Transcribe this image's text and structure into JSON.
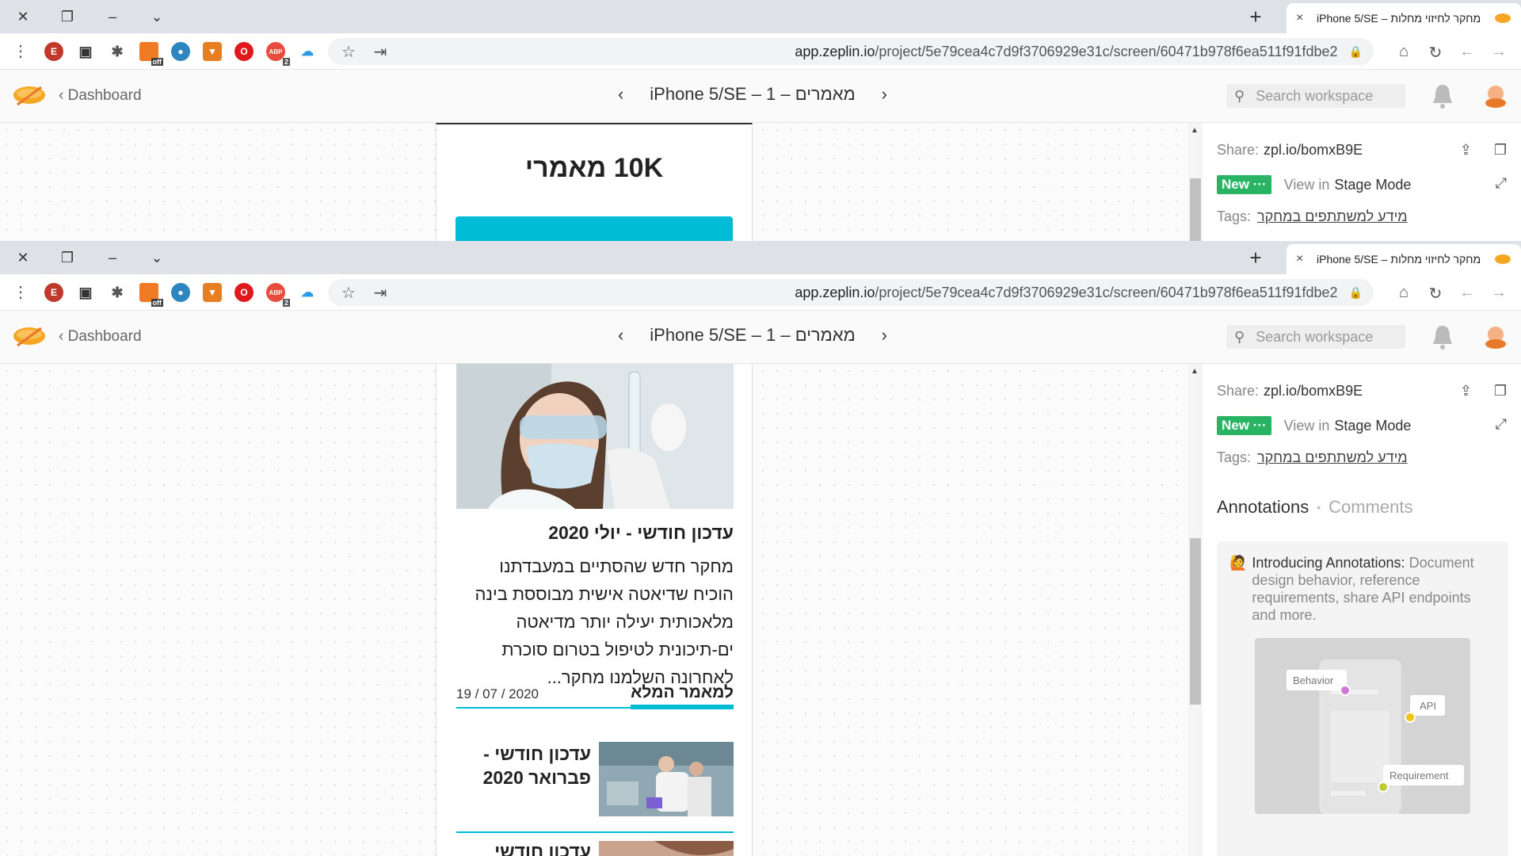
{
  "browser": {
    "tab_title": "iPhone 5/SE – מחקר לחיזוי מחלות",
    "close_glyph": "×",
    "newtab_glyph": "+",
    "url_domain": "app.zeplin.io",
    "url_path": "/project/5e79cea4c7d9f3706929e31c/screen/60471b978f6ea511f91fdbe2",
    "ext_letter": "E",
    "ext_badge_off": "off",
    "ext_badge_abp": "2"
  },
  "zeplin": {
    "back_label": "Dashboard",
    "screen_title": "iPhone 5/SE – 1 – מאמרים",
    "search_placeholder": "Search workspace"
  },
  "panel": {
    "share_label": "Share:",
    "share_link": "zpl.io/bomxB9E",
    "new_badge": "New ···",
    "view_in": "View in",
    "stage_mode": "Stage Mode",
    "tags_label": "Tags:",
    "tag": "מידע למשתתפים במחקר",
    "tab_annotations": "Annotations",
    "tab_separator": "•",
    "tab_comments": "Comments",
    "intro_title": "Introducing Annotations:",
    "intro_text": "Document design behavior, reference requirements, share API endpoints and more.",
    "illus_behavior": "Behavior",
    "illus_api": "API",
    "illus_requirement": "Requirement"
  },
  "artboard_top": {
    "heading": "10K מאמרי"
  },
  "artboard_main": {
    "article_title": "עדכון חודשי - יולי 2020",
    "article_body": "מחקר חדש שהסתיים במעבדתנו הוכיח שדיאטה אישית מבוססת בינה מלאכותית יעילה יותר מדיאטה ים-תיכונית לטיפול בטרום סוכרת לאחרונה השלמנו מחקר...",
    "read_more": "למאמר המלא",
    "date": "19 / 07 / 2020",
    "item2_title": "עדכון חודשי - פברואר 2020",
    "item3_title": "עדכון חודשי"
  },
  "colors": {
    "accent": "#00bcd4",
    "new_green": "#28b463",
    "titlebar": "#dee1e6"
  }
}
